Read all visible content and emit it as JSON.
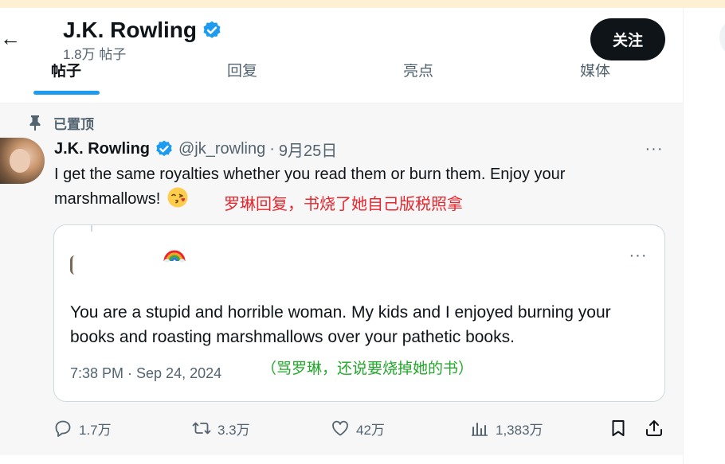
{
  "header": {
    "back_label": "←",
    "display_name": "J.K. Rowling",
    "post_count": "1.8万 帖子",
    "follow_label": "关注",
    "tabs": [
      {
        "label": "帖子"
      },
      {
        "label": "回复"
      },
      {
        "label": "亮点"
      },
      {
        "label": "媒体"
      }
    ]
  },
  "tweet": {
    "pinned_label": "已置顶",
    "author_name": "J.K. Rowling",
    "author_handle": "@jk_rowling",
    "separator": "·",
    "date": "9月25日",
    "more_label": "···",
    "text": "I get the same royalties whether you read them or burn them. Enjoy your marshmallows!",
    "annotation": "罗琳回复，书烧了她自己版税照拿",
    "quote": {
      "more_label": "···",
      "text": "You are a stupid and horrible woman. My kids and I enjoyed burning your books and roasting marshmallows over your pathetic books.",
      "time": "7:38 PM · Sep 24, 2024",
      "annotation": "（骂罗琳，还说要烧掉她的书）"
    },
    "actions": {
      "replies": "1.7万",
      "reposts": "3.3万",
      "likes": "42万",
      "views": "1,383万"
    }
  },
  "colors": {
    "accent": "#1d9bf0",
    "annotation_red": "#e8262e",
    "annotation_green": "#22a82a",
    "follow_bg": "#0f1419",
    "muted_text": "#536471"
  },
  "icons": [
    "back-arrow-icon",
    "verified-badge-icon",
    "pin-icon",
    "more-icon",
    "rainbow-icon",
    "kissing-face-icon",
    "reply-icon",
    "repost-icon",
    "like-icon",
    "views-icon",
    "bookmark-icon",
    "share-icon"
  ]
}
